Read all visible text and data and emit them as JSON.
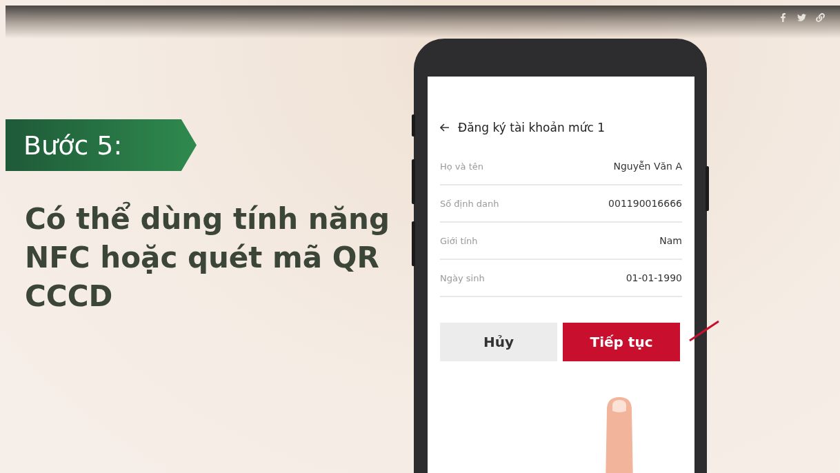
{
  "step": {
    "label": "Bước 5:"
  },
  "heading": "Có thể dùng tính năng NFC hoặc quét mã QR CCCD",
  "phone": {
    "title": "Đăng ký tài khoản mức 1",
    "rows": [
      {
        "label": "Họ và tên",
        "value": "Nguyễn Văn A"
      },
      {
        "label": "Số định danh",
        "value": "001190016666"
      },
      {
        "label": "Giới tính",
        "value": "Nam"
      },
      {
        "label": "Ngày sinh",
        "value": "01-01-1990"
      }
    ],
    "buttons": [
      {
        "label": "Hủy",
        "kind": "secondary"
      },
      {
        "label": "Tiếp tục",
        "kind": "primary"
      }
    ]
  }
}
